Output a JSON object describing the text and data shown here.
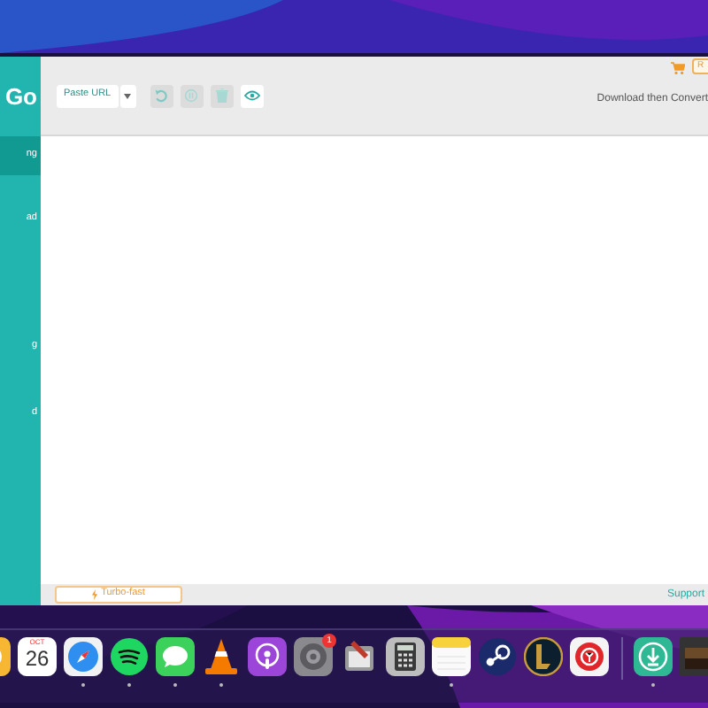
{
  "sidebar": {
    "logo": "Go",
    "items": [
      {
        "label": "ng",
        "selected": true
      },
      {
        "label": "ad",
        "selected": false
      },
      {
        "label": "g",
        "selected": false
      },
      {
        "label": "d",
        "selected": false
      }
    ]
  },
  "toolbar": {
    "paste_button": "Paste URL",
    "mode_label": "Download then Convert",
    "upgrade_button": "R"
  },
  "footer": {
    "turbo_button": "Turbo-fast",
    "support_link": "Support"
  },
  "dock": {
    "items": [
      {
        "kind": "partial",
        "running": false
      },
      {
        "kind": "calendar",
        "month": "OCT",
        "day": "26",
        "running": false
      },
      {
        "kind": "compass",
        "running": true
      },
      {
        "kind": "spotify",
        "running": true
      },
      {
        "kind": "messages",
        "running": true
      },
      {
        "kind": "cone",
        "running": true
      },
      {
        "kind": "podcasts",
        "running": false
      },
      {
        "kind": "gear",
        "badge": "1",
        "running": false
      },
      {
        "kind": "script",
        "running": false
      },
      {
        "kind": "calculator",
        "running": false
      },
      {
        "kind": "notes",
        "running": true
      },
      {
        "kind": "steam",
        "running": false
      },
      {
        "kind": "league",
        "running": false
      },
      {
        "kind": "redapp",
        "running": false
      },
      {
        "kind": "divider"
      },
      {
        "kind": "downloader",
        "running": true
      },
      {
        "kind": "thumb",
        "running": false
      }
    ]
  }
}
